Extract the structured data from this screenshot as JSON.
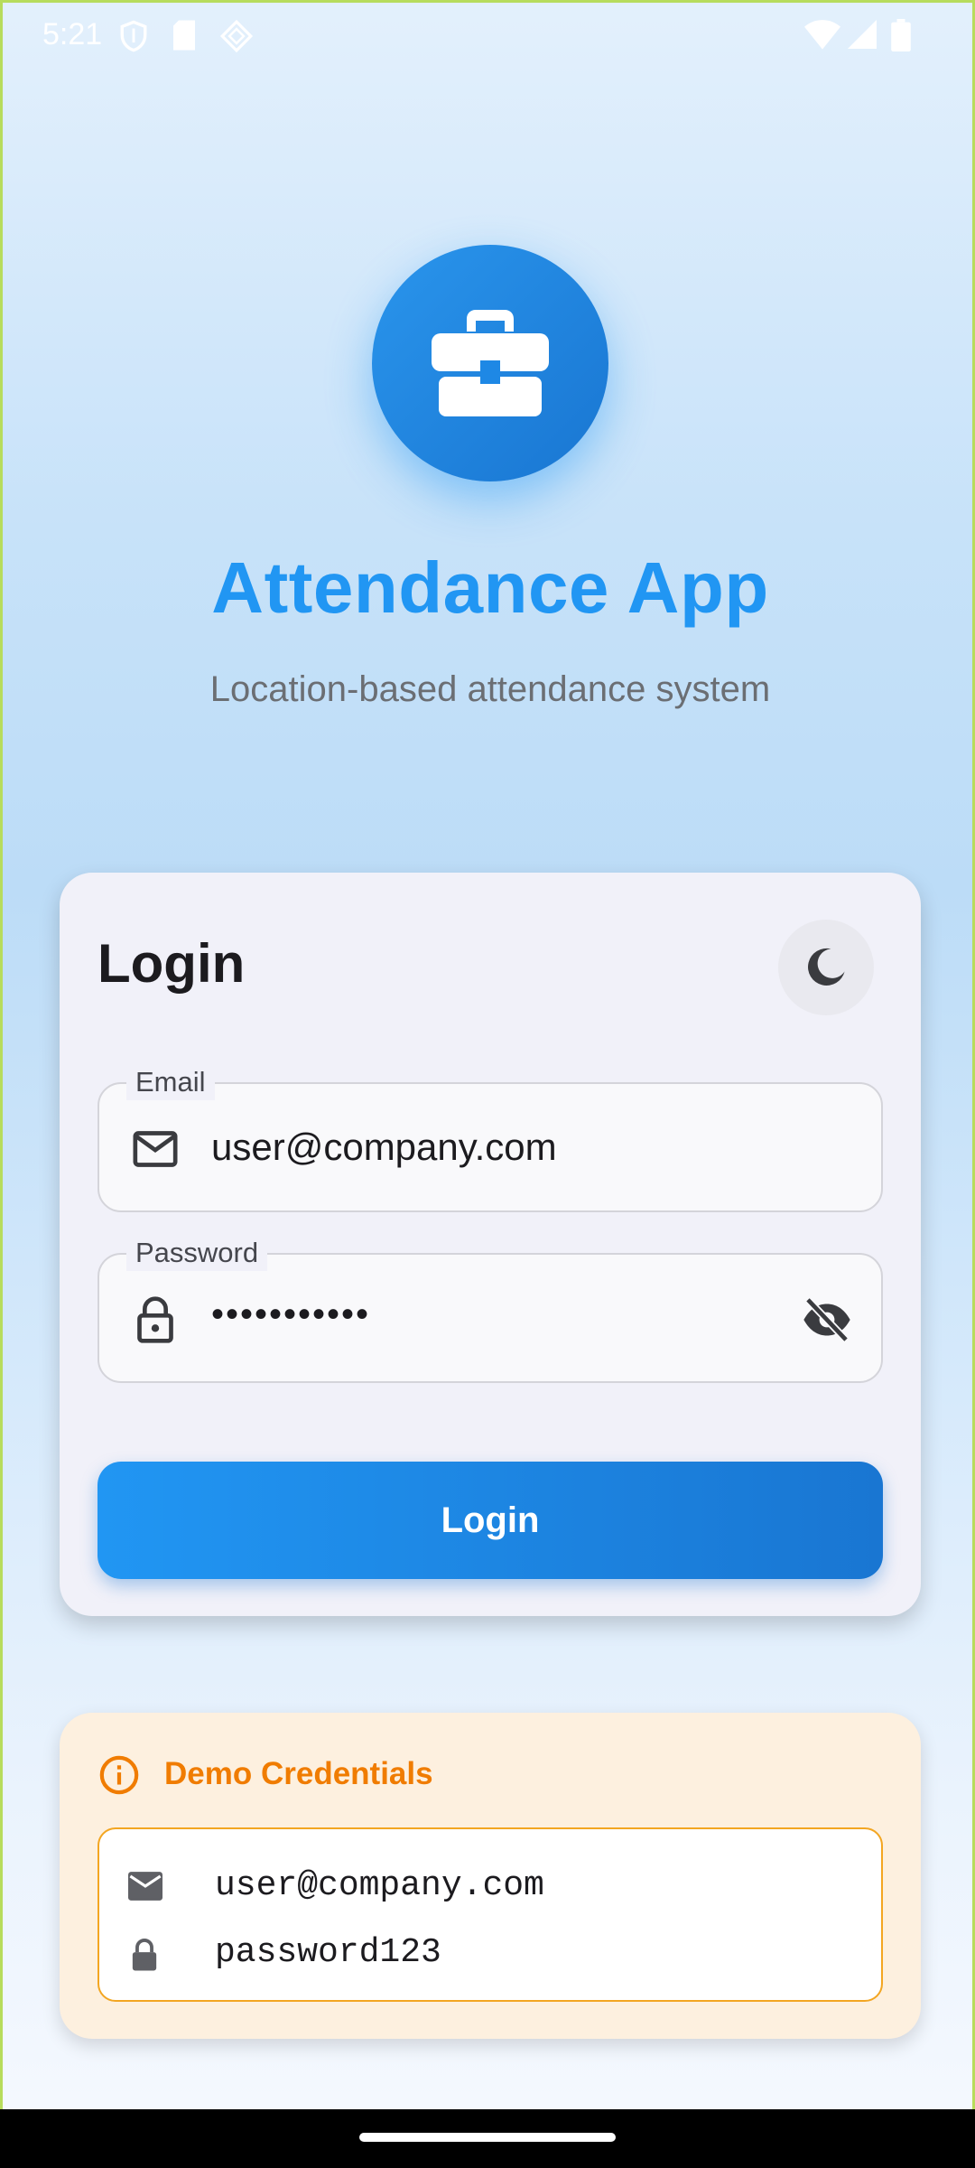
{
  "status_bar": {
    "time": "5:21",
    "left_icons": [
      "shield-icon",
      "sd-card-icon",
      "diamond-icon"
    ],
    "right_icons": [
      "wifi-icon",
      "signal-icon",
      "battery-icon"
    ]
  },
  "header": {
    "logo_icon": "briefcase-icon",
    "title": "Attendance App",
    "subtitle": "Location-based attendance system"
  },
  "login_card": {
    "title": "Login",
    "theme_toggle_icon": "moon-icon",
    "email": {
      "label": "Email",
      "value": "user@company.com",
      "icon": "mail-outline-icon"
    },
    "password": {
      "label": "Password",
      "value": "•••••••••••",
      "icon": "lock-icon",
      "toggle_icon": "eye-off-icon"
    },
    "submit_label": "Login"
  },
  "demo": {
    "title": "Demo Credentials",
    "icon": "info-icon",
    "email": "user@company.com",
    "password": "password123"
  },
  "colors": {
    "primary": "#2196f3",
    "primary_dark": "#1976d2",
    "demo_accent": "#f07c00",
    "demo_border": "#f3a622"
  }
}
